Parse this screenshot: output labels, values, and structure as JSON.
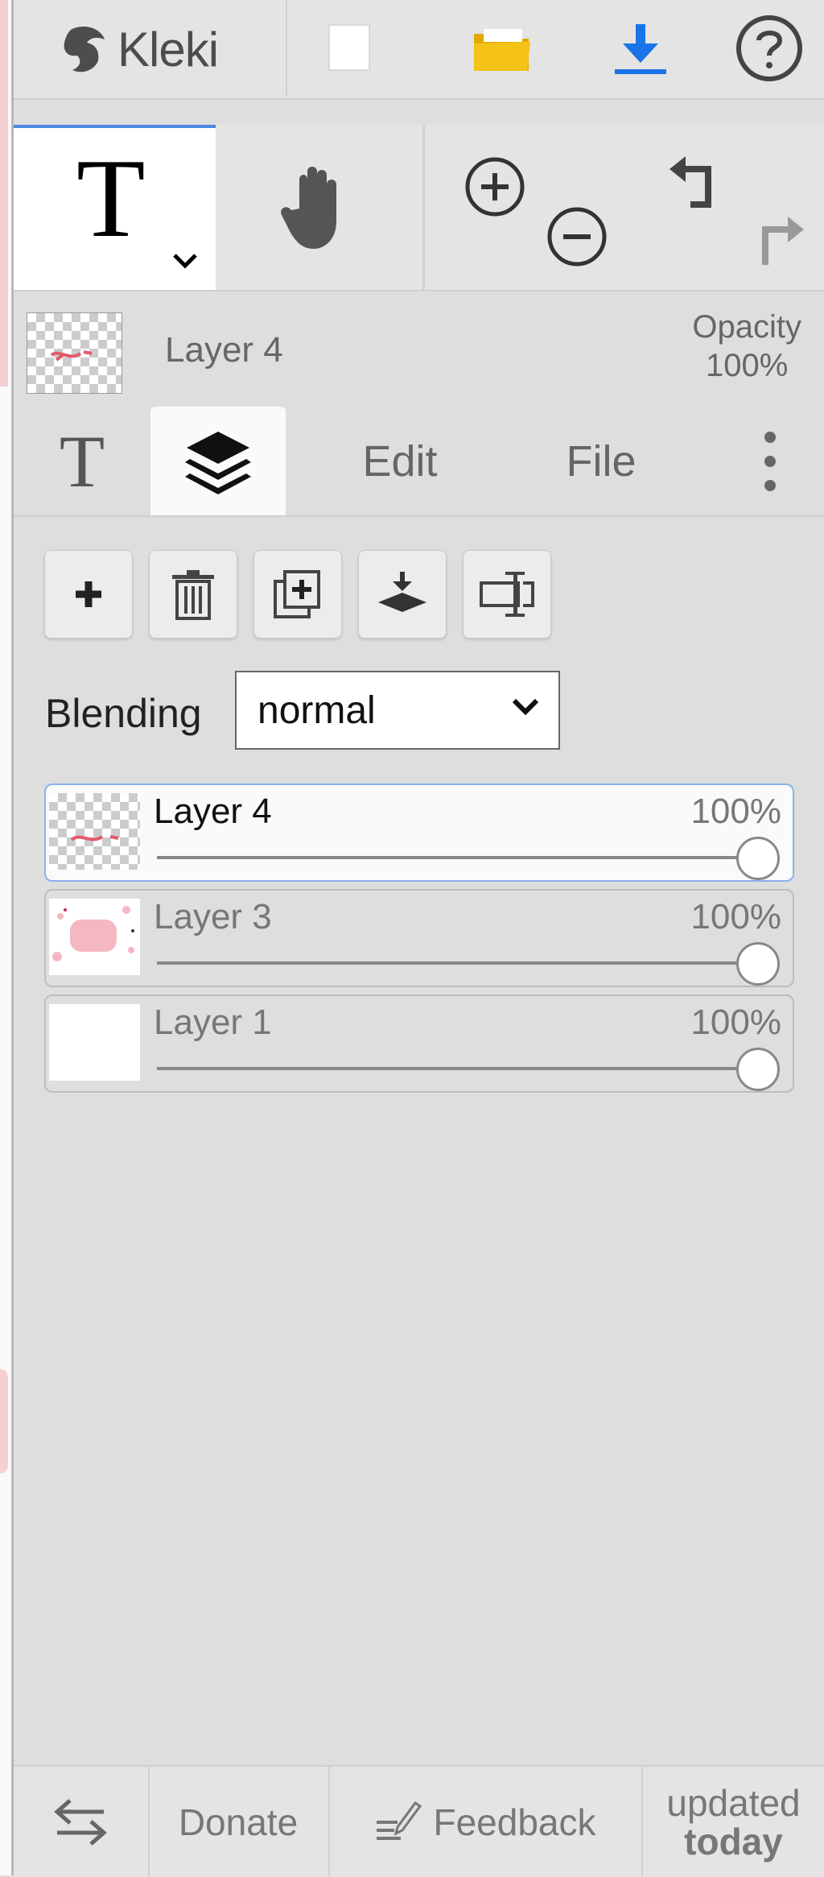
{
  "app": {
    "name": "Kleki"
  },
  "topbar": {
    "new_icon": "new-image-icon",
    "open_icon": "folder-open-icon",
    "save_icon": "download-icon",
    "help_icon": "help-icon"
  },
  "tools": {
    "active_tool": "text-tool-icon",
    "hand_icon": "hand-tool-icon",
    "zoom_in_icon": "zoom-in-icon",
    "zoom_out_icon": "zoom-out-icon",
    "undo_icon": "undo-icon",
    "redo_icon": "redo-icon"
  },
  "current_layer": {
    "name": "Layer 4",
    "opacity_label": "Opacity",
    "opacity_value": "100%"
  },
  "tabs": [
    {
      "label": "T",
      "active": false
    },
    {
      "icon": "layers-icon",
      "active": true
    },
    {
      "label": "Edit",
      "active": false
    },
    {
      "label": "File",
      "active": false
    },
    {
      "icon": "more-vertical-icon",
      "active": false
    }
  ],
  "layer_actions": [
    "add-layer-icon",
    "delete-layer-icon",
    "duplicate-layer-icon",
    "merge-down-icon",
    "rename-layer-icon"
  ],
  "blending": {
    "label": "Blending",
    "value": "normal"
  },
  "layers": [
    {
      "name": "Layer 4",
      "opacity": "100%",
      "opacity_fraction": 1.0,
      "active": true
    },
    {
      "name": "Layer 3",
      "opacity": "100%",
      "opacity_fraction": 1.0,
      "active": false
    },
    {
      "name": "Layer 1",
      "opacity": "100%",
      "opacity_fraction": 1.0,
      "active": false
    }
  ],
  "bottombar": {
    "swap_icon": "swap-sides-icon",
    "donate": "Donate",
    "feedback": "Feedback",
    "updated_line1": "updated",
    "updated_line2": "today"
  },
  "colors": {
    "accent": "#4a87e0",
    "save": "#1a73e8",
    "folder": "#f5c218"
  }
}
